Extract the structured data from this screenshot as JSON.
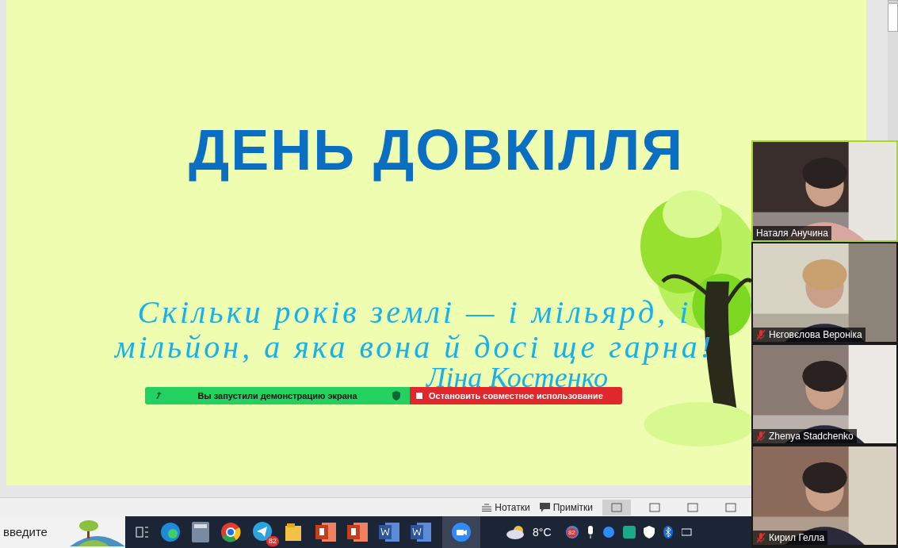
{
  "slide": {
    "title": "ДЕНЬ ДОВКІЛЛЯ",
    "quote": "Скільки років землі — і мільярд, і мільйон, а яка вона й досі ще гарна!",
    "author": "Ліна Костенко"
  },
  "share_bar": {
    "status": "Вы запустили демонстрацию экрана",
    "stop": "Остановить совместное использование"
  },
  "participants": [
    {
      "name": "Наталя Анучина",
      "muted": false,
      "active": true
    },
    {
      "name": "Нєговєлова Вероніка",
      "muted": true,
      "active": false
    },
    {
      "name": "Zhenya Stadchenko",
      "muted": true,
      "active": false
    },
    {
      "name": "Кирил Гелла",
      "muted": true,
      "active": false
    }
  ],
  "status_bar": {
    "notes": "Нотатки",
    "comments": "Примітки"
  },
  "taskbar": {
    "search": "введите",
    "telegram_badge": "82",
    "weather": "8°C",
    "tray_badge": "82"
  }
}
